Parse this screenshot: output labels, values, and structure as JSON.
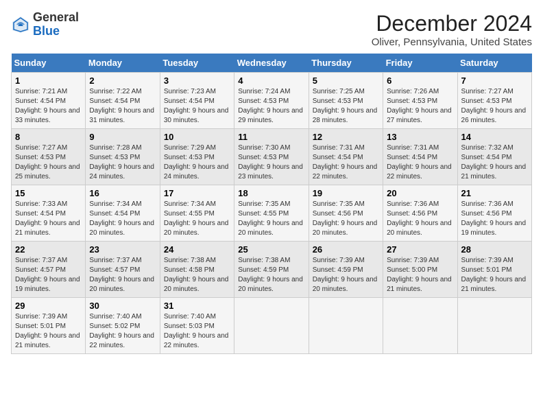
{
  "header": {
    "logo_line1": "General",
    "logo_line2": "Blue",
    "month": "December 2024",
    "location": "Oliver, Pennsylvania, United States"
  },
  "weekdays": [
    "Sunday",
    "Monday",
    "Tuesday",
    "Wednesday",
    "Thursday",
    "Friday",
    "Saturday"
  ],
  "weeks": [
    [
      {
        "day": "1",
        "sunrise": "Sunrise: 7:21 AM",
        "sunset": "Sunset: 4:54 PM",
        "daylight": "Daylight: 9 hours and 33 minutes."
      },
      {
        "day": "2",
        "sunrise": "Sunrise: 7:22 AM",
        "sunset": "Sunset: 4:54 PM",
        "daylight": "Daylight: 9 hours and 31 minutes."
      },
      {
        "day": "3",
        "sunrise": "Sunrise: 7:23 AM",
        "sunset": "Sunset: 4:54 PM",
        "daylight": "Daylight: 9 hours and 30 minutes."
      },
      {
        "day": "4",
        "sunrise": "Sunrise: 7:24 AM",
        "sunset": "Sunset: 4:53 PM",
        "daylight": "Daylight: 9 hours and 29 minutes."
      },
      {
        "day": "5",
        "sunrise": "Sunrise: 7:25 AM",
        "sunset": "Sunset: 4:53 PM",
        "daylight": "Daylight: 9 hours and 28 minutes."
      },
      {
        "day": "6",
        "sunrise": "Sunrise: 7:26 AM",
        "sunset": "Sunset: 4:53 PM",
        "daylight": "Daylight: 9 hours and 27 minutes."
      },
      {
        "day": "7",
        "sunrise": "Sunrise: 7:27 AM",
        "sunset": "Sunset: 4:53 PM",
        "daylight": "Daylight: 9 hours and 26 minutes."
      }
    ],
    [
      {
        "day": "8",
        "sunrise": "Sunrise: 7:27 AM",
        "sunset": "Sunset: 4:53 PM",
        "daylight": "Daylight: 9 hours and 25 minutes."
      },
      {
        "day": "9",
        "sunrise": "Sunrise: 7:28 AM",
        "sunset": "Sunset: 4:53 PM",
        "daylight": "Daylight: 9 hours and 24 minutes."
      },
      {
        "day": "10",
        "sunrise": "Sunrise: 7:29 AM",
        "sunset": "Sunset: 4:53 PM",
        "daylight": "Daylight: 9 hours and 24 minutes."
      },
      {
        "day": "11",
        "sunrise": "Sunrise: 7:30 AM",
        "sunset": "Sunset: 4:53 PM",
        "daylight": "Daylight: 9 hours and 23 minutes."
      },
      {
        "day": "12",
        "sunrise": "Sunrise: 7:31 AM",
        "sunset": "Sunset: 4:54 PM",
        "daylight": "Daylight: 9 hours and 22 minutes."
      },
      {
        "day": "13",
        "sunrise": "Sunrise: 7:31 AM",
        "sunset": "Sunset: 4:54 PM",
        "daylight": "Daylight: 9 hours and 22 minutes."
      },
      {
        "day": "14",
        "sunrise": "Sunrise: 7:32 AM",
        "sunset": "Sunset: 4:54 PM",
        "daylight": "Daylight: 9 hours and 21 minutes."
      }
    ],
    [
      {
        "day": "15",
        "sunrise": "Sunrise: 7:33 AM",
        "sunset": "Sunset: 4:54 PM",
        "daylight": "Daylight: 9 hours and 21 minutes."
      },
      {
        "day": "16",
        "sunrise": "Sunrise: 7:34 AM",
        "sunset": "Sunset: 4:54 PM",
        "daylight": "Daylight: 9 hours and 20 minutes."
      },
      {
        "day": "17",
        "sunrise": "Sunrise: 7:34 AM",
        "sunset": "Sunset: 4:55 PM",
        "daylight": "Daylight: 9 hours and 20 minutes."
      },
      {
        "day": "18",
        "sunrise": "Sunrise: 7:35 AM",
        "sunset": "Sunset: 4:55 PM",
        "daylight": "Daylight: 9 hours and 20 minutes."
      },
      {
        "day": "19",
        "sunrise": "Sunrise: 7:35 AM",
        "sunset": "Sunset: 4:56 PM",
        "daylight": "Daylight: 9 hours and 20 minutes."
      },
      {
        "day": "20",
        "sunrise": "Sunrise: 7:36 AM",
        "sunset": "Sunset: 4:56 PM",
        "daylight": "Daylight: 9 hours and 20 minutes."
      },
      {
        "day": "21",
        "sunrise": "Sunrise: 7:36 AM",
        "sunset": "Sunset: 4:56 PM",
        "daylight": "Daylight: 9 hours and 19 minutes."
      }
    ],
    [
      {
        "day": "22",
        "sunrise": "Sunrise: 7:37 AM",
        "sunset": "Sunset: 4:57 PM",
        "daylight": "Daylight: 9 hours and 19 minutes."
      },
      {
        "day": "23",
        "sunrise": "Sunrise: 7:37 AM",
        "sunset": "Sunset: 4:57 PM",
        "daylight": "Daylight: 9 hours and 20 minutes."
      },
      {
        "day": "24",
        "sunrise": "Sunrise: 7:38 AM",
        "sunset": "Sunset: 4:58 PM",
        "daylight": "Daylight: 9 hours and 20 minutes."
      },
      {
        "day": "25",
        "sunrise": "Sunrise: 7:38 AM",
        "sunset": "Sunset: 4:59 PM",
        "daylight": "Daylight: 9 hours and 20 minutes."
      },
      {
        "day": "26",
        "sunrise": "Sunrise: 7:39 AM",
        "sunset": "Sunset: 4:59 PM",
        "daylight": "Daylight: 9 hours and 20 minutes."
      },
      {
        "day": "27",
        "sunrise": "Sunrise: 7:39 AM",
        "sunset": "Sunset: 5:00 PM",
        "daylight": "Daylight: 9 hours and 21 minutes."
      },
      {
        "day": "28",
        "sunrise": "Sunrise: 7:39 AM",
        "sunset": "Sunset: 5:01 PM",
        "daylight": "Daylight: 9 hours and 21 minutes."
      }
    ],
    [
      {
        "day": "29",
        "sunrise": "Sunrise: 7:39 AM",
        "sunset": "Sunset: 5:01 PM",
        "daylight": "Daylight: 9 hours and 21 minutes."
      },
      {
        "day": "30",
        "sunrise": "Sunrise: 7:40 AM",
        "sunset": "Sunset: 5:02 PM",
        "daylight": "Daylight: 9 hours and 22 minutes."
      },
      {
        "day": "31",
        "sunrise": "Sunrise: 7:40 AM",
        "sunset": "Sunset: 5:03 PM",
        "daylight": "Daylight: 9 hours and 22 minutes."
      },
      null,
      null,
      null,
      null
    ]
  ]
}
